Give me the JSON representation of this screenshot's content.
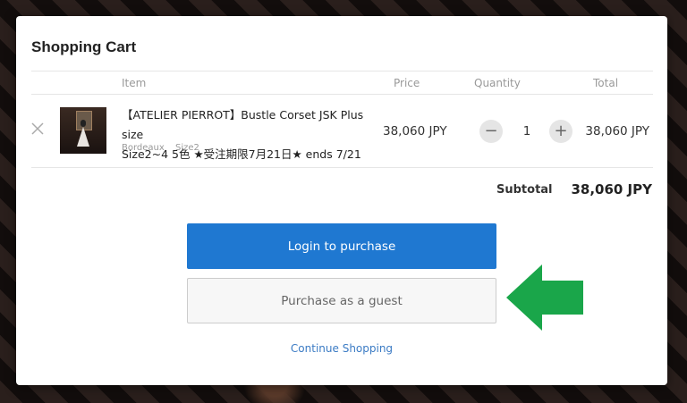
{
  "cart": {
    "title": "Shopping Cart",
    "headers": {
      "item": "Item",
      "price": "Price",
      "quantity": "Quantity",
      "total": "Total"
    },
    "items": [
      {
        "name_line1": "【ATELIER PIERROT】Bustle Corset JSK Plus size",
        "name_line2": "Size2~4 5色 ★受注期限7月21日★ ends 7/21",
        "variant_color": "Bordeaux",
        "variant_size": "Size2",
        "price": "38,060 JPY",
        "quantity": "1",
        "total": "38,060 JPY"
      }
    ],
    "subtotal_label": "Subtotal",
    "subtotal_value": "38,060 JPY",
    "login_button": "Login to purchase",
    "guest_button": "Purchase as a guest",
    "continue_link": "Continue Shopping"
  },
  "icons": {
    "remove": "close-icon",
    "decrease": "minus-icon",
    "increase": "plus-icon",
    "annotation": "arrow-left-icon"
  },
  "colors": {
    "primary_button": "#1f78d1",
    "link": "#3b7bc4",
    "annotation_arrow": "#1aa64a"
  }
}
